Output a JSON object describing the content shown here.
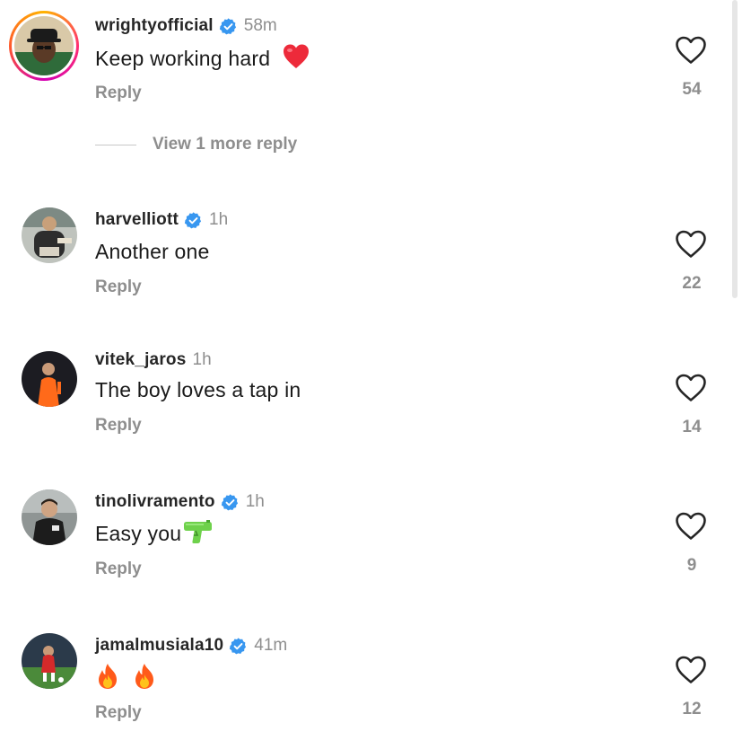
{
  "comments": [
    {
      "username": "wrightyofficial",
      "verified": true,
      "time": "58m",
      "text": "Keep working hard",
      "emoji": "heart-emoji",
      "reply_label": "Reply",
      "likes": "54",
      "more_replies": "View 1 more reply"
    },
    {
      "username": "harvelliott",
      "verified": true,
      "time": "1h",
      "text": "Another one",
      "reply_label": "Reply",
      "likes": "22"
    },
    {
      "username": "vitek_jaros",
      "verified": false,
      "time": "1h",
      "text": "The boy loves a tap in",
      "reply_label": "Reply",
      "likes": "14"
    },
    {
      "username": "tinolivramento",
      "verified": true,
      "time": "1h",
      "text": "Easy you",
      "emoji": "water-pistol-emoji",
      "reply_label": "Reply",
      "likes": "9"
    },
    {
      "username": "jamalmusiala10",
      "verified": true,
      "time": "41m",
      "text": "",
      "emoji": "fire-emoji x2",
      "reply_label": "Reply",
      "likes": "12"
    }
  ],
  "colors": {
    "verified_blue": "#3897f0",
    "muted_text": "#8e8e8e",
    "primary_text": "#262626",
    "heart_red": "#ed2a3a",
    "pistol_green": "#6ed14b",
    "fire_orange": "#ff7a1a"
  }
}
